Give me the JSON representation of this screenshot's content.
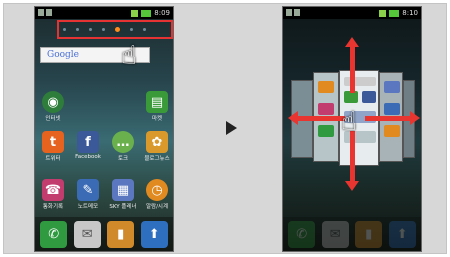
{
  "left_phone": {
    "status_time": "8:09",
    "search_placeholder": "Google",
    "apps": [
      {
        "label": "인터넷",
        "icon": "globe-icon",
        "color": "#2f7d3a"
      },
      {
        "label": "마켓",
        "icon": "market-icon",
        "color": "#3a9a3a"
      },
      {
        "label": "트위터",
        "icon": "twitter-icon",
        "color": "#e5621f"
      },
      {
        "label": "Facebook",
        "icon": "facebook-icon",
        "color": "#3b5998"
      },
      {
        "label": "토크",
        "icon": "talk-icon",
        "color": "#6ab04c"
      },
      {
        "label": "블로그뉴스",
        "icon": "blog-icon",
        "color": "#d99a2b"
      },
      {
        "label": "통화기록",
        "icon": "call-log-icon",
        "color": "#c23c6e"
      },
      {
        "label": "노트메모",
        "icon": "memo-icon",
        "color": "#3c6bb5"
      },
      {
        "label": "SKY 플레너",
        "icon": "calendar-icon",
        "color": "#5b77bf"
      },
      {
        "label": "알람/시계",
        "icon": "clock-icon",
        "color": "#e08a20"
      }
    ],
    "dock": [
      {
        "icon": "phone-icon",
        "color": "#2f9a3f"
      },
      {
        "icon": "mail-icon",
        "color": "#c8c8c8"
      },
      {
        "icon": "contacts-icon",
        "color": "#d08a2a"
      },
      {
        "icon": "menu-icon",
        "color": "#2f6fc0"
      }
    ]
  },
  "right_phone": {
    "status_time": "8:10"
  },
  "colors": {
    "highlight": "#e53232",
    "arrow": "#e8352f",
    "active_dot": "#ff8c1a"
  }
}
